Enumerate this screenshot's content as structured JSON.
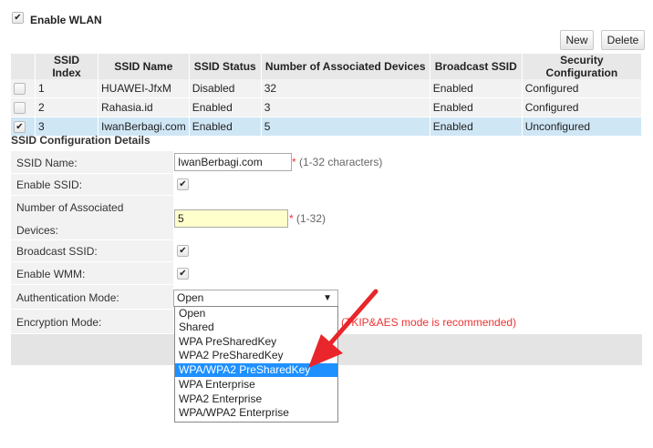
{
  "wlan": {
    "enable_label": "Enable WLAN",
    "enable_checked": true
  },
  "buttons": {
    "new_label": "New",
    "delete_label": "Delete"
  },
  "ssid_table": {
    "headers": [
      "SSID Index",
      "SSID Name",
      "SSID Status",
      "Number of Associated Devices",
      "Broadcast SSID",
      "Security Configuration"
    ],
    "rows": [
      {
        "index": "1",
        "name": "HUAWEI-JfxM",
        "status": "Disabled",
        "devices": "32",
        "broadcast": "Enabled",
        "security": "Configured",
        "checked": false
      },
      {
        "index": "2",
        "name": "Rahasia.id",
        "status": "Enabled",
        "devices": "3",
        "broadcast": "Enabled",
        "security": "Configured",
        "checked": false
      },
      {
        "index": "3",
        "name": "IwanBerbagi.com",
        "status": "Enabled",
        "devices": "5",
        "broadcast": "Enabled",
        "security": "Unconfigured",
        "checked": true
      }
    ]
  },
  "config": {
    "title": "SSID Configuration Details",
    "ssid_name_label": "SSID Name:",
    "ssid_name_value": "IwanBerbagi.com",
    "ssid_name_hint": "(1-32 characters)",
    "enable_ssid_label": "Enable SSID:",
    "num_devices_label_line1": "Number of Associated",
    "num_devices_label_line2": "Devices:",
    "num_devices_value": "5",
    "num_devices_hint": "(1-32)",
    "broadcast_label": "Broadcast SSID:",
    "wmm_label": "Enable WMM:",
    "auth_label": "Authentication Mode:",
    "auth_selected": "Open",
    "encryption_label": "Encryption Mode:",
    "encryption_hint": "(TKIP&AES mode is recommended)",
    "star": "*"
  },
  "auth_options": [
    "Open",
    "Shared",
    "WPA PreSharedKey",
    "WPA2 PreSharedKey",
    "WPA/WPA2 PreSharedKey",
    "WPA Enterprise",
    "WPA2 Enterprise",
    "WPA/WPA2 Enterprise"
  ],
  "highlighted_option": "WPA/WPA2 PreSharedKey",
  "colors": {
    "accent_highlight": "#1e90ff",
    "arrow": "#e8262b",
    "selected_row": "#cfe6f5",
    "required_star": "#e33333"
  },
  "icons": {
    "checkbox": "check-icon",
    "select_caret": "caret-down-icon",
    "annotation": "red-arrow-icon"
  }
}
